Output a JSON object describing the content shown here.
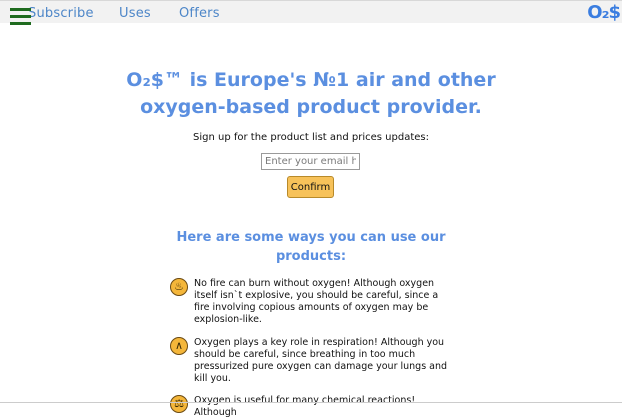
{
  "nav": {
    "items": [
      {
        "label": "Subscribe"
      },
      {
        "label": "Uses"
      },
      {
        "label": "Offers"
      }
    ],
    "logo_text": "O₂$"
  },
  "hero": {
    "headline_line1": "O₂$™ is Europe's №1 air and other",
    "headline_line2": "oxygen-based product provider."
  },
  "signup": {
    "prompt": "Sign up for the product list and prices updates:",
    "email_placeholder": "Enter your email here",
    "confirm_label": "Confirm"
  },
  "uses": {
    "title_line1": "Here are some ways you can use our",
    "title_line2": "products:",
    "items": [
      {
        "icon": "fire-icon",
        "text": "No fire can burn without oxygen! Although oxygen itself isn`t explosive, you should be careful, since a fire involving copious amounts of oxygen may be explosion-like."
      },
      {
        "icon": "lungs-icon",
        "text": "Oxygen plays a key role in respiration! Although you should be careful, since breathing in too much pressurized pure oxygen can damage your lungs and kill you."
      },
      {
        "icon": "flask-icon",
        "text": "Oxygen is useful for many chemical reactions! Although"
      }
    ]
  },
  "colors": {
    "accent": "#5b8fe0",
    "nav_link": "#4d86c8",
    "button": "#f7c25a",
    "hamburger": "#1f6b1f"
  }
}
